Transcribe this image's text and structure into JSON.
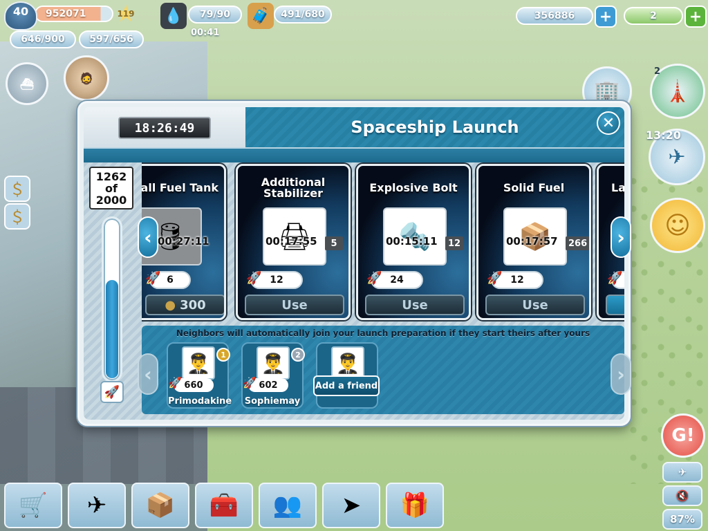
{
  "hud": {
    "level": "40",
    "xp": "952071",
    "stars": "119",
    "passengers": "646/900",
    "workers": "597/656",
    "fuel": "79/90",
    "fuel_timer": "00:41",
    "cargo": "491/680",
    "coins": "356886",
    "bucks": "2",
    "airport_count": "2",
    "flight_timer": "13:20",
    "zoom": "87%"
  },
  "modal": {
    "timer": "18:26:49",
    "title": "Spaceship Launch",
    "close_label": "✕",
    "progress": {
      "current": "1262",
      "of_label": "of",
      "total": "2000",
      "fraction": 0.631
    },
    "cards": [
      {
        "title": "nall Fuel Tank",
        "timer": "00:27:11",
        "points": "6",
        "button": "300",
        "icon": "fuel-tank-icon",
        "glyph": "🛢"
      },
      {
        "title": "Additional Stabilizer",
        "timer": "00:17:55",
        "count": "5",
        "points": "12",
        "button": "Use",
        "icon": "stabilizer-icon",
        "glyph": "🖨"
      },
      {
        "title": "Explosive Bolt",
        "timer": "00:15:11",
        "count": "12",
        "points": "24",
        "button": "Use",
        "icon": "bolt-icon",
        "glyph": "🔩"
      },
      {
        "title": "Solid Fuel",
        "timer": "00:17:57",
        "count": "266",
        "points": "12",
        "button": "Use",
        "icon": "solid-fuel-icon",
        "glyph": "📦"
      },
      {
        "title": "La"
      }
    ],
    "neighbors_info": "Neighbors will automatically join your launch preparation if they start theirs after yours",
    "neighbors": [
      {
        "name": "Primodakine",
        "points": "660",
        "medal": "1",
        "medal_color": "#d8a628"
      },
      {
        "name": "Sophiemay",
        "points": "602",
        "medal": "2",
        "medal_color": "#9aa6b2"
      }
    ],
    "add_friend_label": "Add a friend"
  },
  "colors": {
    "accent": "#2b87ab",
    "progress_fill": "#3ea6dc",
    "card_bg": "#0b1e36"
  }
}
